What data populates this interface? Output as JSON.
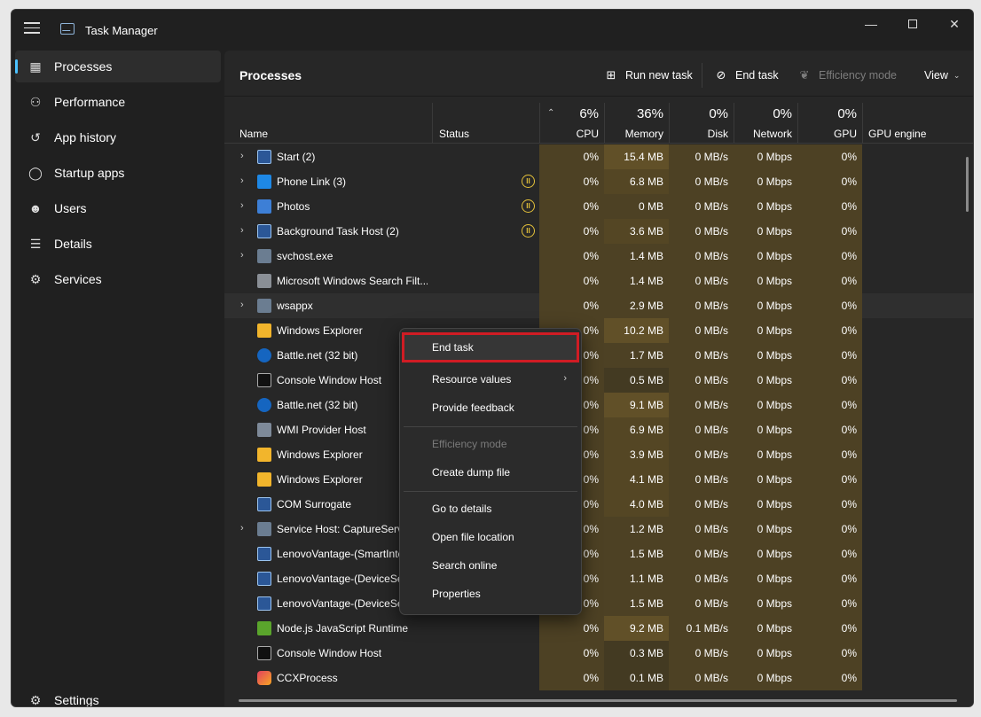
{
  "window": {
    "title": "Task Manager",
    "controls": [
      "minimize",
      "maximize",
      "close"
    ]
  },
  "sidebar": {
    "items": [
      {
        "label": "Processes",
        "icon": "processes-icon",
        "active": true
      },
      {
        "label": "Performance",
        "icon": "performance-icon"
      },
      {
        "label": "App history",
        "icon": "app-history-icon"
      },
      {
        "label": "Startup apps",
        "icon": "startup-icon"
      },
      {
        "label": "Users",
        "icon": "users-icon"
      },
      {
        "label": "Details",
        "icon": "details-icon"
      },
      {
        "label": "Services",
        "icon": "services-icon"
      }
    ],
    "settings": "Settings"
  },
  "toolbar": {
    "title": "Processes",
    "run_new_task": "Run new task",
    "end_task": "End task",
    "efficiency_mode": "Efficiency mode",
    "view": "View"
  },
  "columns": {
    "name": "Name",
    "status": "Status",
    "cpu": {
      "pct": "6%",
      "label": "CPU"
    },
    "memory": {
      "pct": "36%",
      "label": "Memory"
    },
    "disk": {
      "pct": "0%",
      "label": "Disk"
    },
    "network": {
      "pct": "0%",
      "label": "Network"
    },
    "gpu": {
      "pct": "0%",
      "label": "GPU"
    },
    "gpu_engine": "GPU engine"
  },
  "processes": [
    {
      "name": "Start (2)",
      "expand": true,
      "paused": false,
      "cpu": "0%",
      "mem": "15.4 MB",
      "disk": "0 MB/s",
      "net": "0 Mbps",
      "gpu": "0%"
    },
    {
      "name": "Phone Link (3)",
      "expand": true,
      "paused": true,
      "cpu": "0%",
      "mem": "6.8 MB",
      "disk": "0 MB/s",
      "net": "0 Mbps",
      "gpu": "0%"
    },
    {
      "name": "Photos",
      "expand": true,
      "paused": true,
      "cpu": "0%",
      "mem": "0 MB",
      "disk": "0 MB/s",
      "net": "0 Mbps",
      "gpu": "0%"
    },
    {
      "name": "Background Task Host (2)",
      "expand": true,
      "paused": true,
      "cpu": "0%",
      "mem": "3.6 MB",
      "disk": "0 MB/s",
      "net": "0 Mbps",
      "gpu": "0%"
    },
    {
      "name": "svchost.exe",
      "expand": true,
      "paused": false,
      "cpu": "0%",
      "mem": "1.4 MB",
      "disk": "0 MB/s",
      "net": "0 Mbps",
      "gpu": "0%"
    },
    {
      "name": "Microsoft Windows Search Filt...",
      "expand": false,
      "paused": false,
      "cpu": "0%",
      "mem": "1.4 MB",
      "disk": "0 MB/s",
      "net": "0 Mbps",
      "gpu": "0%"
    },
    {
      "name": "wsappx",
      "expand": true,
      "paused": false,
      "cpu": "0%",
      "mem": "2.9 MB",
      "disk": "0 MB/s",
      "net": "0 Mbps",
      "gpu": "0%"
    },
    {
      "name": "Windows Explorer",
      "expand": false,
      "paused": false,
      "cpu": "0%",
      "mem": "10.2 MB",
      "disk": "0 MB/s",
      "net": "0 Mbps",
      "gpu": "0%"
    },
    {
      "name": "Battle.net (32 bit)",
      "expand": false,
      "paused": false,
      "cpu": "0%",
      "mem": "1.7 MB",
      "disk": "0 MB/s",
      "net": "0 Mbps",
      "gpu": "0%"
    },
    {
      "name": "Console Window Host",
      "expand": false,
      "paused": false,
      "cpu": "0%",
      "mem": "0.5 MB",
      "disk": "0 MB/s",
      "net": "0 Mbps",
      "gpu": "0%"
    },
    {
      "name": "Battle.net (32 bit)",
      "expand": false,
      "paused": false,
      "cpu": "0%",
      "mem": "9.1 MB",
      "disk": "0 MB/s",
      "net": "0 Mbps",
      "gpu": "0%"
    },
    {
      "name": "WMI Provider Host",
      "expand": false,
      "paused": false,
      "cpu": "0%",
      "mem": "6.9 MB",
      "disk": "0 MB/s",
      "net": "0 Mbps",
      "gpu": "0%"
    },
    {
      "name": "Windows Explorer",
      "expand": false,
      "paused": false,
      "cpu": "0%",
      "mem": "3.9 MB",
      "disk": "0 MB/s",
      "net": "0 Mbps",
      "gpu": "0%"
    },
    {
      "name": "Windows Explorer",
      "expand": false,
      "paused": false,
      "cpu": "0%",
      "mem": "4.1 MB",
      "disk": "0 MB/s",
      "net": "0 Mbps",
      "gpu": "0%"
    },
    {
      "name": "COM Surrogate",
      "expand": false,
      "paused": false,
      "cpu": "0%",
      "mem": "4.0 MB",
      "disk": "0 MB/s",
      "net": "0 Mbps",
      "gpu": "0%"
    },
    {
      "name": "Service Host: CaptureServi",
      "expand": true,
      "paused": false,
      "cpu": "0%",
      "mem": "1.2 MB",
      "disk": "0 MB/s",
      "net": "0 Mbps",
      "gpu": "0%"
    },
    {
      "name": "LenovoVantage-(SmartInte",
      "expand": false,
      "paused": false,
      "cpu": "0%",
      "mem": "1.5 MB",
      "disk": "0 MB/s",
      "net": "0 Mbps",
      "gpu": "0%"
    },
    {
      "name": "LenovoVantage-(DeviceSe",
      "expand": false,
      "paused": false,
      "cpu": "0%",
      "mem": "1.1 MB",
      "disk": "0 MB/s",
      "net": "0 Mbps",
      "gpu": "0%"
    },
    {
      "name": "LenovoVantage-(DeviceSe",
      "expand": false,
      "paused": false,
      "cpu": "0%",
      "mem": "1.5 MB",
      "disk": "0 MB/s",
      "net": "0 Mbps",
      "gpu": "0%"
    },
    {
      "name": "Node.js JavaScript Runtime",
      "expand": false,
      "paused": false,
      "cpu": "0%",
      "mem": "9.2 MB",
      "disk": "0.1 MB/s",
      "net": "0 Mbps",
      "gpu": "0%"
    },
    {
      "name": "Console Window Host",
      "expand": false,
      "paused": false,
      "cpu": "0%",
      "mem": "0.3 MB",
      "disk": "0 MB/s",
      "net": "0 Mbps",
      "gpu": "0%"
    },
    {
      "name": "CCXProcess",
      "expand": false,
      "paused": false,
      "cpu": "0%",
      "mem": "0.1 MB",
      "disk": "0 MB/s",
      "net": "0 Mbps",
      "gpu": "0%"
    }
  ],
  "context_menu": {
    "end_task": "End task",
    "resource_values": "Resource values",
    "provide_feedback": "Provide feedback",
    "efficiency_mode": "Efficiency mode",
    "create_dump_file": "Create dump file",
    "go_to_details": "Go to details",
    "open_file_location": "Open file location",
    "search_online": "Search online",
    "properties": "Properties"
  },
  "colors": {
    "accent": "#4cc2ff",
    "highlight_border": "#d01c24",
    "heat": "#4d4124",
    "paused": "#e3c03a"
  }
}
